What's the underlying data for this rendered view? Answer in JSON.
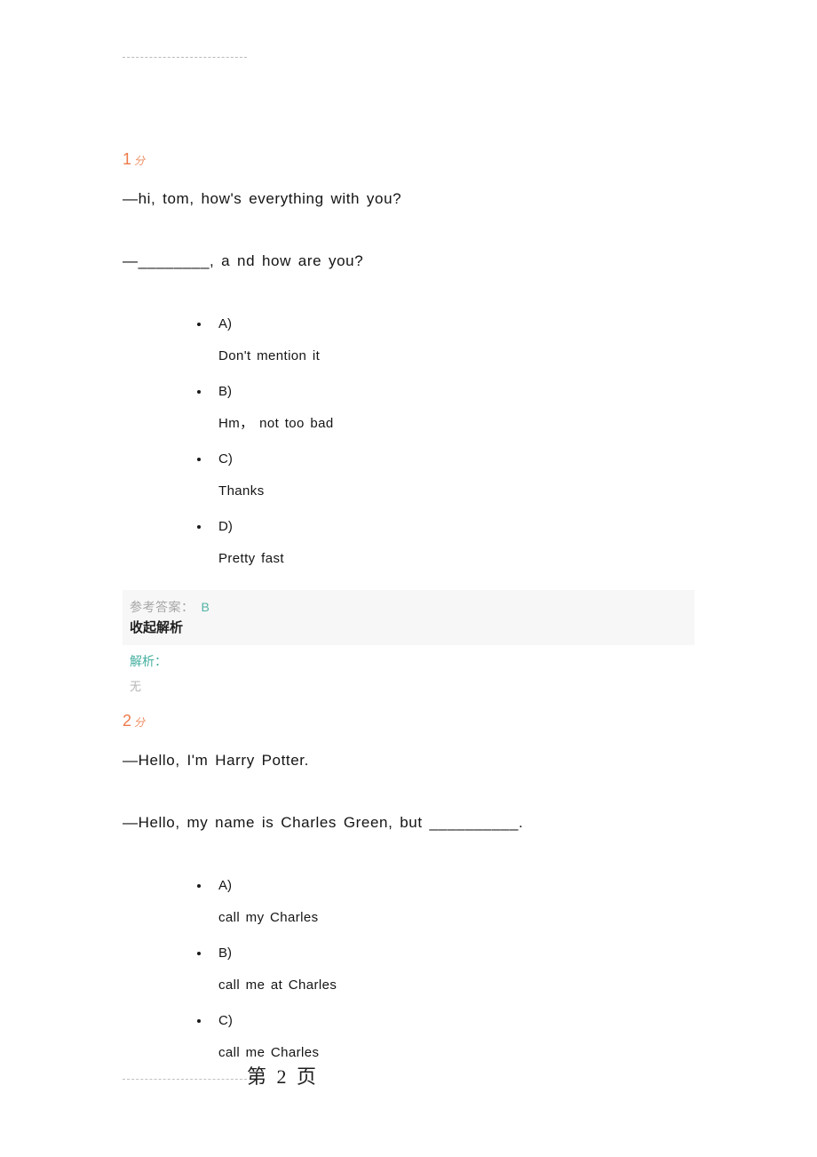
{
  "document": {
    "top_rule": "dashed-rule",
    "footer": {
      "page_text": "第 2 页"
    }
  },
  "questions": [
    {
      "score_num": "1",
      "score_unit": "分",
      "prompt_lines": [
        "—hi,  tom,  how's  everything  with  you?",
        "—________,  a nd  how  are  you?"
      ],
      "options": [
        {
          "letter": "A)",
          "text": "Don't  mention  it"
        },
        {
          "letter": "B)",
          "text": "Hm，   not  too  bad"
        },
        {
          "letter": "C)",
          "text": "Thanks"
        },
        {
          "letter": "D)",
          "text": "Pretty  fast"
        }
      ],
      "answer_label": "参考答案：",
      "answer_value": "B",
      "collapse_label": "收起解析",
      "explain_label": "解析：",
      "explain_body": "无"
    },
    {
      "score_num": "2",
      "score_unit": "分",
      "prompt_lines": [
        "—Hello,  I'm  Harry  Potter.",
        "—Hello,  my  name  is  Charles  Green,  but  __________."
      ],
      "options": [
        {
          "letter": "A)",
          "text": "call  my  Charles"
        },
        {
          "letter": "B)",
          "text": "call  me  at  Charles"
        },
        {
          "letter": "C)",
          "text": "call  me  Charles"
        }
      ]
    }
  ],
  "colors": {
    "score_accent": "#ed7a4a",
    "answer_accent": "#52b3a4",
    "explain_accent": "#45b0a0",
    "panel_bg": "#f7f7f7",
    "muted": "#b5b5b5"
  }
}
